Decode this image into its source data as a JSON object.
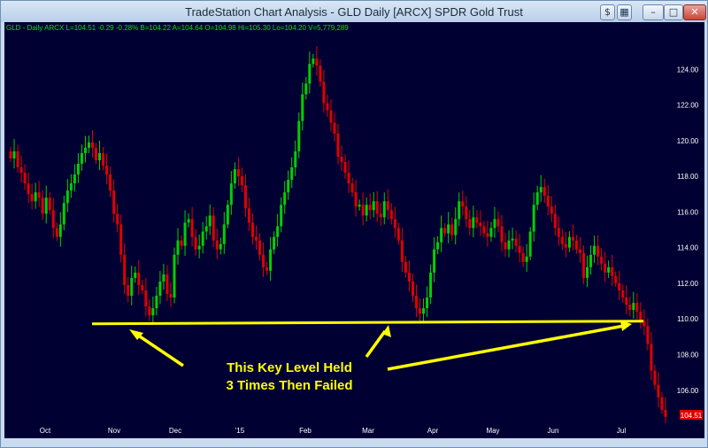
{
  "window": {
    "title": "TradeStation Chart Analysis - GLD Daily [ARCX] SPDR Gold Trust"
  },
  "legend": {
    "text": "GLD - Daily  ARCX  L=104.51  -0.29  -0.28%  B=104.22  A=104.64  O=104.98  Hi=105.30  Lo=104.20  V=5,779,289"
  },
  "annotation": {
    "line1": "This Key Level Held",
    "line2": "3 Times Then Failed"
  },
  "colors": {
    "background": "#000033",
    "up": "#00d000",
    "down": "#e00000",
    "level_line": "#ffff00",
    "axis_text": "#ffffff",
    "last_price_box": "#e00000"
  },
  "chart_data": {
    "type": "candlestick",
    "symbol": "GLD",
    "interval": "Daily",
    "ylim": [
      104.3,
      125.9
    ],
    "yticks": [
      106,
      108,
      110,
      112,
      114,
      116,
      118,
      120,
      122,
      124
    ],
    "xticks": [
      {
        "label": "Oct",
        "month": "Oct"
      },
      {
        "label": "Nov",
        "month": "Nov"
      },
      {
        "label": "Dec",
        "month": "Dec"
      },
      {
        "label": "'15",
        "month": "Jan"
      },
      {
        "label": "Feb",
        "month": "Feb"
      },
      {
        "label": "Mar",
        "month": "Mar"
      },
      {
        "label": "Apr",
        "month": "Apr"
      },
      {
        "label": "May",
        "month": "May"
      },
      {
        "label": "Jun",
        "month": "Jun"
      },
      {
        "label": "Jul",
        "month": "Jul"
      }
    ],
    "last_price": 104.51,
    "last_price_label": "104.51",
    "key_level": 109.8,
    "key_level_tests": [
      {
        "month": "Nov",
        "approx_low": 109.8
      },
      {
        "month": "Mar",
        "approx_low": 109.8
      },
      {
        "month": "Jul",
        "approx_low": 109.8
      }
    ],
    "approx_closes": [
      119.0,
      119.4,
      118.5,
      118.2,
      117.6,
      117.0,
      116.6,
      117.1,
      116.8,
      115.9,
      116.8,
      116.1,
      115.1,
      114.6,
      115.3,
      116.5,
      117.2,
      117.6,
      118.1,
      118.7,
      119.3,
      119.6,
      119.9,
      119.6,
      118.9,
      119.3,
      118.6,
      118.1,
      117.2,
      115.9,
      115.3,
      113.6,
      111.9,
      111.3,
      112.3,
      112.6,
      111.9,
      111.6,
      110.7,
      110.2,
      110.6,
      111.3,
      112.1,
      112.5,
      111.4,
      111.2,
      113.6,
      114.4,
      114.1,
      115.4,
      115.6,
      114.6,
      113.9,
      114.1,
      114.9,
      115.2,
      115.8,
      114.4,
      113.9,
      114.2,
      115.3,
      116.4,
      117.6,
      118.4,
      118.0,
      117.5,
      116.2,
      115.4,
      114.6,
      114.4,
      113.6,
      112.9,
      112.7,
      113.9,
      114.6,
      115.2,
      116.4,
      117.1,
      117.8,
      118.5,
      119.4,
      121.1,
      122.6,
      123.2,
      124.3,
      124.6,
      124.2,
      123.3,
      122.1,
      121.7,
      121.0,
      120.4,
      119.1,
      118.8,
      118.2,
      117.6,
      117.1,
      116.3,
      116.4,
      115.8,
      116.4,
      116.1,
      116.6,
      115.9,
      115.7,
      116.6,
      116.1,
      115.6,
      115.1,
      114.4,
      113.2,
      112.6,
      112.1,
      111.3,
      110.6,
      110.3,
      110.6,
      111.2,
      112.6,
      113.9,
      114.3,
      115.1,
      114.8,
      115.3,
      114.7,
      115.6,
      116.6,
      116.3,
      115.6,
      115.1,
      115.7,
      115.4,
      115.2,
      114.8,
      114.6,
      115.1,
      115.6,
      115.2,
      114.3,
      113.9,
      114.4,
      114.5,
      114.1,
      113.7,
      113.2,
      113.5,
      114.9,
      116.4,
      117.1,
      117.4,
      116.9,
      116.3,
      115.9,
      115.1,
      114.6,
      114.2,
      114.0,
      114.6,
      114.4,
      113.9,
      113.7,
      112.3,
      112.9,
      113.6,
      114.1,
      113.5,
      113.1,
      112.6,
      112.9,
      112.4,
      112.0,
      111.6,
      111.2,
      110.8,
      110.5,
      110.9,
      110.4,
      109.9,
      109.6,
      108.6,
      107.1,
      106.3,
      105.6,
      104.9,
      104.51
    ]
  }
}
